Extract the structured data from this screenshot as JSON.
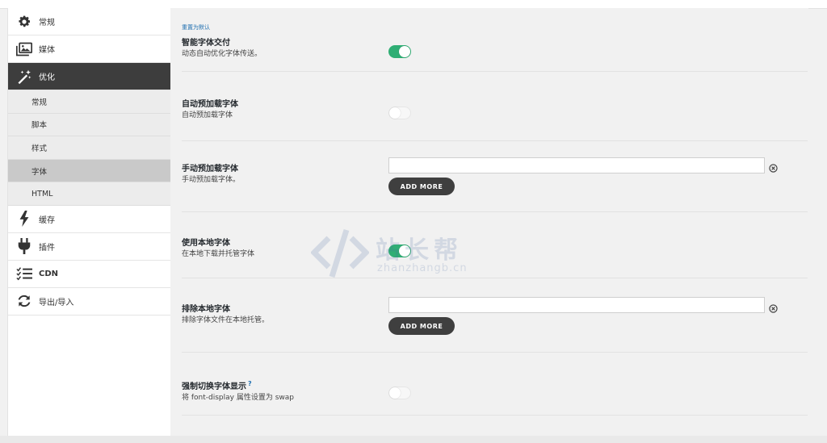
{
  "sidebar": {
    "items": [
      {
        "label": "常规",
        "icon": "gear-icon"
      },
      {
        "label": "媒体",
        "icon": "images-icon"
      },
      {
        "label": "优化",
        "icon": "magic-wand-icon"
      },
      {
        "label": "缓存",
        "icon": "bolt-icon"
      },
      {
        "label": "插件",
        "icon": "plug-icon"
      },
      {
        "label": "CDN",
        "icon": "checklist-icon"
      },
      {
        "label": "导出/导入",
        "icon": "sync-icon"
      }
    ],
    "active_item": "优化",
    "subitems": [
      {
        "label": "常规"
      },
      {
        "label": "脚本"
      },
      {
        "label": "样式"
      },
      {
        "label": "字体"
      },
      {
        "label": "HTML"
      }
    ],
    "active_subitem": "字体"
  },
  "main": {
    "reset_label": "重置为默认",
    "settings": [
      {
        "title": "智能字体交付",
        "description": "动态自动优化字体传送。",
        "type": "toggle",
        "enabled": true
      },
      {
        "title": "自动预加载字体",
        "description": "自动预加载字体",
        "type": "toggle",
        "enabled": false
      },
      {
        "title": "手动预加载字体",
        "description": "手动预加载字体。",
        "type": "list",
        "input_value": "",
        "button_label": "ADD MORE"
      },
      {
        "title": "使用本地字体",
        "description": "在本地下载并托管字体",
        "type": "toggle",
        "enabled": true
      },
      {
        "title": "排除本地字体",
        "description": "排除字体文件在本地托管。",
        "type": "list",
        "input_value": "",
        "button_label": "ADD MORE"
      },
      {
        "title": "强制切换字体显示",
        "help": "?",
        "description": "将 font-display 属性设置为 swap",
        "type": "toggle",
        "enabled": false
      }
    ]
  },
  "watermark": {
    "text": "站长帮",
    "subtext": "zhanzhangb.cn"
  },
  "colors": {
    "accent": "#2fae74",
    "active_nav": "#3d3d3d",
    "button": "#3f3f3f",
    "link": "#2271b1"
  }
}
